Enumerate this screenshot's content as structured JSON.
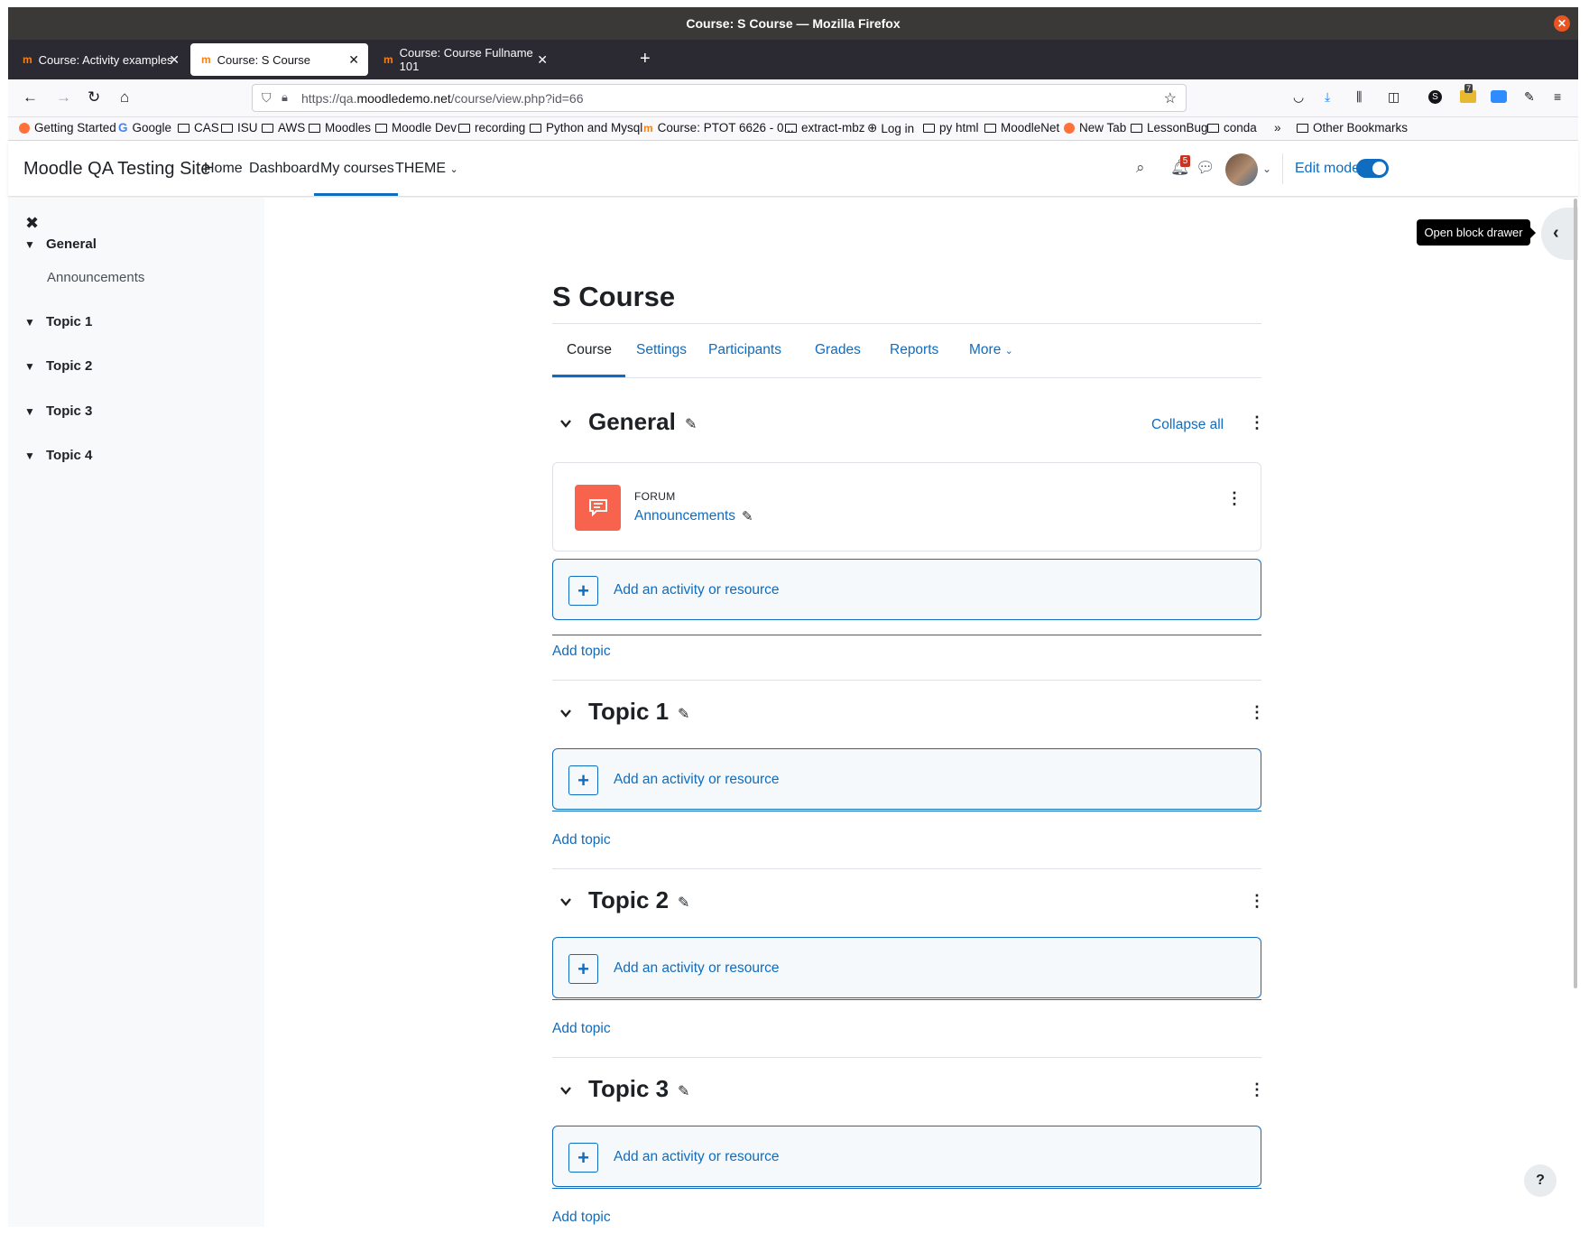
{
  "window": {
    "title": "Course: S Course — Mozilla Firefox"
  },
  "tabs": [
    {
      "label": "Course: Activity examples"
    },
    {
      "label": "Course: S Course"
    },
    {
      "label": "Course: Course Fullname 101"
    }
  ],
  "urlbar": {
    "prefix": "https://qa.",
    "domain": "moodledemo.net",
    "path": "/course/view.php?id=66"
  },
  "toolbar": {
    "downloads_badge": "7"
  },
  "bookmarks": [
    "Getting Started",
    "Google",
    "CAS",
    "ISU",
    "AWS",
    "Moodles",
    "Moodle Dev",
    "recording",
    "Python and Mysql",
    "Course: PTOT 6626 - 0...",
    "extract-mbz",
    "Log in",
    "py html",
    "MoodleNet",
    "New Tab",
    "LessonBug",
    "conda",
    "Other Bookmarks"
  ],
  "header": {
    "site_name": "Moodle QA Testing Site",
    "nav": [
      "Home",
      "Dashboard",
      "My courses",
      "THEME"
    ],
    "notification_count": "5",
    "edit_mode_label": "Edit mode",
    "edit_mode_on": true
  },
  "course_index": {
    "sections": [
      {
        "title": "General",
        "items": [
          "Announcements"
        ]
      },
      {
        "title": "Topic 1",
        "items": []
      },
      {
        "title": "Topic 2",
        "items": []
      },
      {
        "title": "Topic 3",
        "items": []
      },
      {
        "title": "Topic 4",
        "items": []
      }
    ]
  },
  "course": {
    "title": "S Course",
    "tabs": [
      "Course",
      "Settings",
      "Participants",
      "Grades",
      "Reports",
      "More"
    ],
    "collapse_all": "Collapse all",
    "sections": [
      {
        "title": "General",
        "activities": [
          {
            "type": "FORUM",
            "name": "Announcements"
          }
        ]
      },
      {
        "title": "Topic 1",
        "activities": []
      },
      {
        "title": "Topic 2",
        "activities": []
      },
      {
        "title": "Topic 3",
        "activities": []
      }
    ],
    "add_activity_label": "Add an activity or resource",
    "add_topic_label": "Add topic"
  },
  "block_drawer": {
    "tooltip": "Open block drawer"
  },
  "help": {
    "label": "?"
  },
  "colors": {
    "primary": "#0f6cbf",
    "forum": "#f7634d",
    "title_bar": "#3a3937",
    "tab_strip": "#2b2a33"
  }
}
